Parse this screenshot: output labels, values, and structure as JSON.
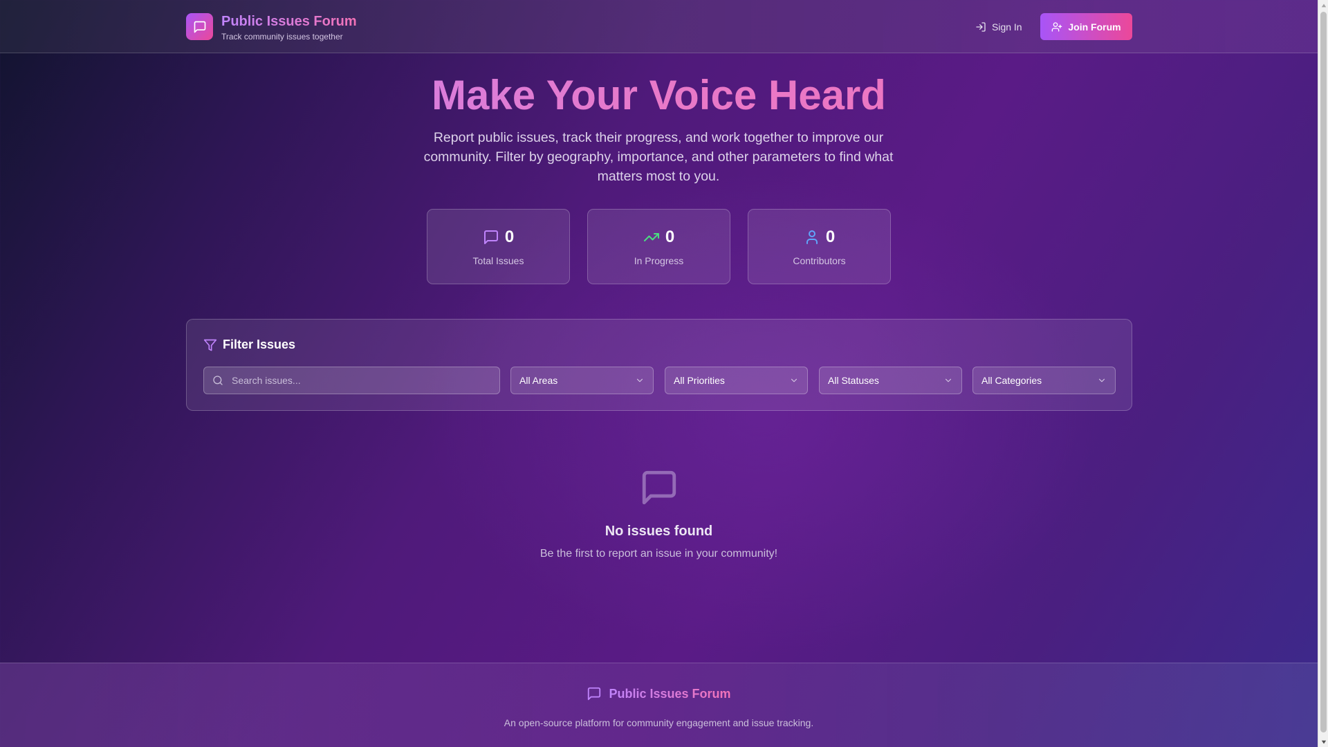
{
  "header": {
    "brand_title": "Public Issues Forum",
    "brand_subtitle": "Track community issues together",
    "sign_in_label": "Sign In",
    "join_label": "Join Forum"
  },
  "hero": {
    "title": "Make Your Voice Heard",
    "description": "Report public issues, track their progress, and work together to improve our community. Filter by geography, importance, and other parameters to find what matters most to you."
  },
  "stats": [
    {
      "value": "0",
      "label": "Total Issues",
      "icon": "message-square-icon",
      "color": "#c084fc"
    },
    {
      "value": "0",
      "label": "In Progress",
      "icon": "trending-up-icon",
      "color": "#4ade80"
    },
    {
      "value": "0",
      "label": "Contributors",
      "icon": "user-icon",
      "color": "#60a5fa"
    }
  ],
  "filters": {
    "heading": "Filter Issues",
    "search_placeholder": "Search issues...",
    "area": "All Areas",
    "priority": "All Priorities",
    "status": "All Statuses",
    "category": "All Categories"
  },
  "empty_state": {
    "title": "No issues found",
    "subtitle": "Be the first to report an issue in your community!"
  },
  "footer": {
    "brand_title": "Public Issues Forum",
    "description": "An open-source platform for community engagement and issue tracking."
  },
  "colors": {
    "accent_purple": "#a855f7",
    "accent_pink": "#ec4899"
  }
}
